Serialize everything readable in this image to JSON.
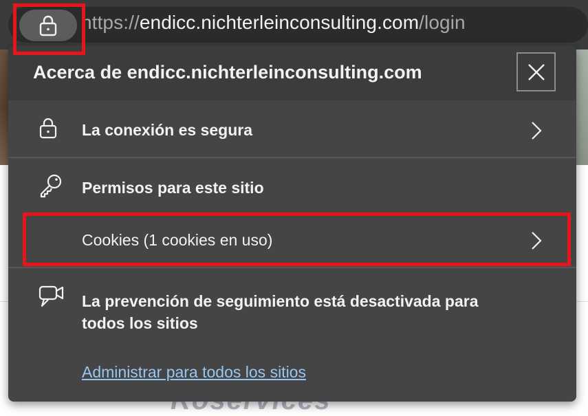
{
  "browser": {
    "url_scheme": "https://",
    "url_host": "endicc.nichterleinconsulting.com",
    "url_path": "/login"
  },
  "popup": {
    "title": "Acerca de endicc.nichterleinconsulting.com",
    "connection_label": "La conexión es segura",
    "permissions_label": "Permisos para este sitio",
    "cookies_label": "Cookies (1 cookies en uso)",
    "tracking_label": "La prevención de seguimiento está desactivada para todos los sitios",
    "manage_link": "Administrar para todos los sitios"
  },
  "icons": [
    "lock-icon",
    "close-icon",
    "chevron-right-icon",
    "key-icon",
    "tracking-prevention-icon"
  ],
  "colors": {
    "annotation_red": "#e8151c",
    "popup_bg": "#454545",
    "link": "#9ac7f2"
  }
}
